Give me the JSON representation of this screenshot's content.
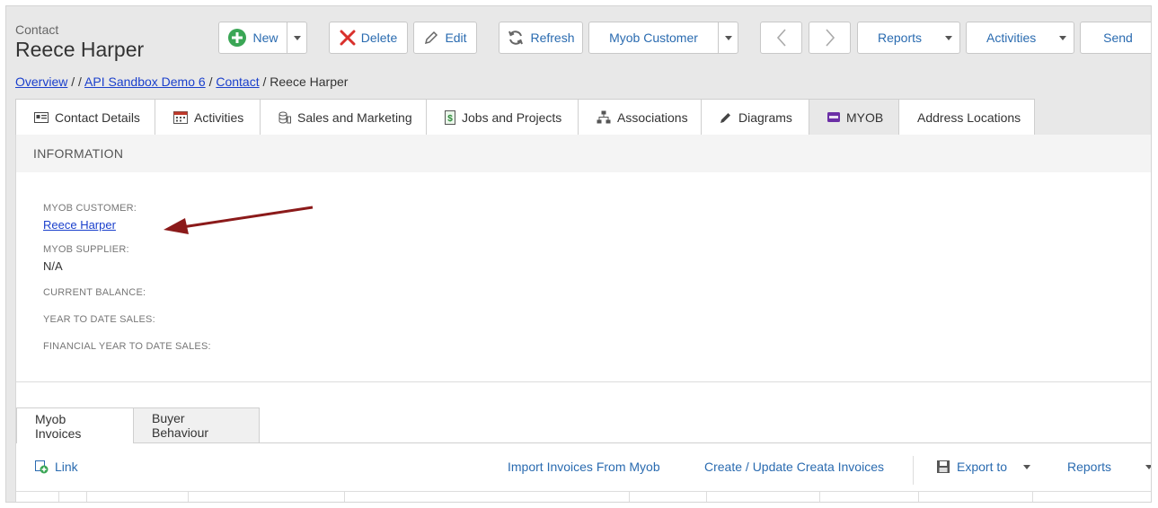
{
  "header": {
    "subtitle": "Contact",
    "title": "Reece Harper"
  },
  "toolbar": {
    "new_label": "New",
    "delete_label": "Delete",
    "edit_label": "Edit",
    "refresh_label": "Refresh",
    "myob_customer_label": "Myob Customer",
    "reports_label": "Reports",
    "activities_label": "Activities",
    "send_label": "Send"
  },
  "breadcrumb": {
    "overview": "Overview",
    "sep1": " / / ",
    "sandbox": "API Sandbox Demo 6",
    "sep2": " / ",
    "contact": "Contact",
    "sep3": " / ",
    "current": "Reece Harper"
  },
  "tabs": [
    {
      "label": "Contact Details"
    },
    {
      "label": "Activities"
    },
    {
      "label": "Sales and Marketing"
    },
    {
      "label": "Jobs and Projects"
    },
    {
      "label": "Associations"
    },
    {
      "label": "Diagrams"
    },
    {
      "label": "MYOB"
    },
    {
      "label": "Address Locations"
    }
  ],
  "info": {
    "header": "INFORMATION",
    "myob_customer_label": "MYOB CUSTOMER:",
    "myob_customer_value": "Reece Harper",
    "myob_supplier_label": "MYOB SUPPLIER:",
    "myob_supplier_value": "N/A",
    "current_balance_label": "CURRENT BALANCE:",
    "ytd_sales_label": "YEAR TO DATE SALES:",
    "fytd_sales_label": "FINANCIAL YEAR TO DATE SALES:"
  },
  "subtabs": [
    {
      "label": "Myob Invoices"
    },
    {
      "label": "Buyer Behaviour"
    }
  ],
  "subtoolbar": {
    "link_label": "Link",
    "import_label": "Import Invoices From Myob",
    "create_label": "Create / Update Creata Invoices",
    "export_label": "Export to",
    "reports_label": "Reports"
  },
  "colors": {
    "accent": "#2a6bb0",
    "link": "#1a3fcc",
    "new_green": "#3aa655",
    "delete_red": "#d9302c",
    "arrow": "#8b1a1a"
  }
}
